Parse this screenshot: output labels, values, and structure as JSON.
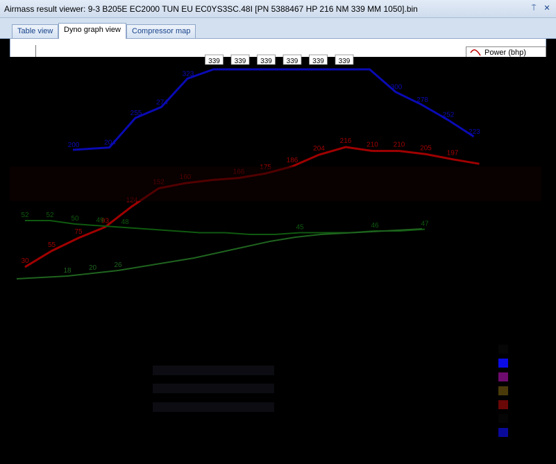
{
  "window": {
    "title": "Airmass result viewer: 9-3 B205E EC2000 TUN EU EC0YS3SC.48I [PN 5388467 HP 216 NM 339 MM 1050].bin",
    "pin_glyph": "⍑",
    "close_glyph": "✕"
  },
  "tabs": [
    {
      "label": "Table view",
      "active": false
    },
    {
      "label": "Dyno graph view",
      "active": true
    },
    {
      "label": "Compressor map",
      "active": false
    }
  ],
  "legend": {
    "first_label": "Power (bhp)"
  },
  "colors": {
    "torque": "#0a0ab4",
    "power": "#a00000",
    "green1": "#0f5a0f",
    "green2": "#1f641f",
    "swatches": [
      "#060606",
      "#0b0be6",
      "#6e0b6e",
      "#4a3a0a",
      "#6a0707",
      "#050505",
      "#0a0a9a"
    ]
  },
  "chart_data": {
    "type": "line",
    "ylim_top_tick": "350",
    "torque": {
      "x": [
        1,
        2,
        3,
        4,
        5,
        6,
        7,
        8,
        9,
        10,
        11,
        12,
        13,
        14,
        15,
        16
      ],
      "values": [
        200,
        204,
        255,
        274,
        323,
        339,
        339,
        339,
        339,
        339,
        339,
        339,
        300,
        278,
        252,
        223
      ],
      "labels": [
        "200",
        "204",
        "255",
        "274",
        "323",
        "339",
        "339",
        "339",
        "339",
        "339",
        "339",
        "",
        "300",
        "278",
        "252",
        "223"
      ]
    },
    "power": {
      "x": [
        1,
        2,
        3,
        4,
        5,
        6,
        7,
        8,
        9,
        10,
        11,
        12,
        13,
        14,
        15,
        16,
        17,
        18
      ],
      "values": [
        30,
        55,
        75,
        92,
        124,
        152,
        160,
        165,
        168,
        175,
        186,
        204,
        216,
        210,
        210,
        205,
        197,
        190
      ],
      "labels": [
        "30",
        "55",
        "75",
        "93",
        "124",
        "152",
        "160",
        "",
        "166",
        "175",
        "186",
        "204",
        "216",
        "210",
        "210",
        "205",
        "197",
        ""
      ]
    },
    "green_upper": {
      "values": [
        52,
        52,
        50,
        49,
        48,
        47,
        46,
        45,
        45,
        44,
        44,
        45,
        45,
        45,
        46,
        46,
        47
      ],
      "labels": [
        "52",
        "52",
        "50",
        "49",
        "48",
        "",
        "",
        "",
        "",
        "",
        "",
        "45",
        "",
        "",
        "46",
        "",
        "47"
      ]
    },
    "green_lower": {
      "values": [
        8,
        9,
        10,
        12,
        14,
        17,
        20,
        23,
        27,
        31,
        35,
        38,
        40,
        41,
        42,
        43,
        44
      ],
      "labels": [
        "",
        "",
        "18",
        "20",
        "26",
        "",
        "",
        "",
        "",
        "",
        "",
        "",
        "",
        "",
        "",
        "",
        ""
      ]
    }
  }
}
